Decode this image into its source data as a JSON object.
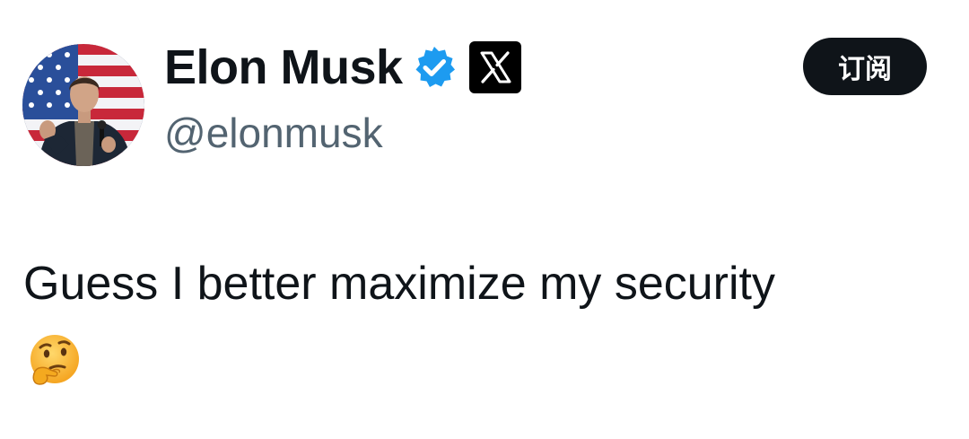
{
  "author": {
    "display_name": "Elon Musk",
    "handle": "@elonmusk",
    "verified_icon": "verified-badge-icon",
    "affiliation_icon": "x-logo-icon",
    "avatar": "profile-photo"
  },
  "actions": {
    "subscribe_label": "订阅"
  },
  "tweet": {
    "text": "Guess I better maximize my security",
    "emoji": "thinking-face-icon"
  },
  "colors": {
    "text_primary": "#0f1419",
    "text_secondary": "#536471",
    "verified_blue": "#1d9bf0",
    "button_bg": "#0f1419",
    "button_text": "#ffffff"
  }
}
